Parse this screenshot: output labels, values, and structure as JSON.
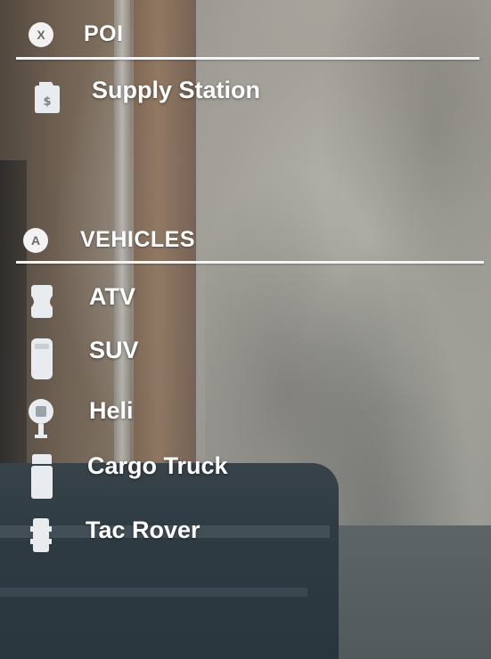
{
  "legend": {
    "poi": {
      "button_glyph": "X",
      "title": "POI",
      "items": [
        {
          "label": "Supply Station",
          "icon": "supply-station-icon"
        }
      ]
    },
    "vehicles": {
      "button_glyph": "A",
      "title": "VEHICLES",
      "items": [
        {
          "label": "ATV",
          "icon": "atv-icon"
        },
        {
          "label": "SUV",
          "icon": "suv-icon"
        },
        {
          "label": "Heli",
          "icon": "heli-icon"
        },
        {
          "label": "Cargo Truck",
          "icon": "cargo-truck-icon"
        },
        {
          "label": "Tac Rover",
          "icon": "tac-rover-icon"
        }
      ]
    }
  },
  "colors": {
    "text": "#ffffff",
    "badge_bg": "#f2f2f2",
    "icon_fill": "#e8ecee"
  }
}
